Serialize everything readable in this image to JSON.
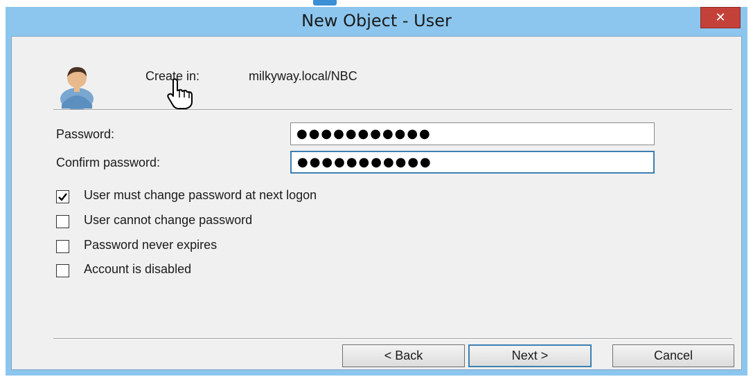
{
  "window": {
    "title": "New Object - User",
    "close_glyph": "✕"
  },
  "header": {
    "create_in_label": "Create in:",
    "create_in_value": "milkyway.local/NBC",
    "icon": "user-icon"
  },
  "form": {
    "password_label": "Password:",
    "password_value": "●●●●●●●●●●●",
    "confirm_label": "Confirm password:",
    "confirm_value": "●●●●●●●●●●●"
  },
  "options": [
    {
      "label": "User must change password at next logon",
      "checked": true
    },
    {
      "label": "User cannot change password",
      "checked": false
    },
    {
      "label": "Password never expires",
      "checked": false
    },
    {
      "label": "Account is disabled",
      "checked": false
    }
  ],
  "buttons": {
    "back": "< Back",
    "next": "Next >",
    "cancel": "Cancel"
  },
  "colors": {
    "titlebar": "#8cc6ee",
    "close": "#c4413a",
    "focus_border": "#3c7fb1"
  }
}
